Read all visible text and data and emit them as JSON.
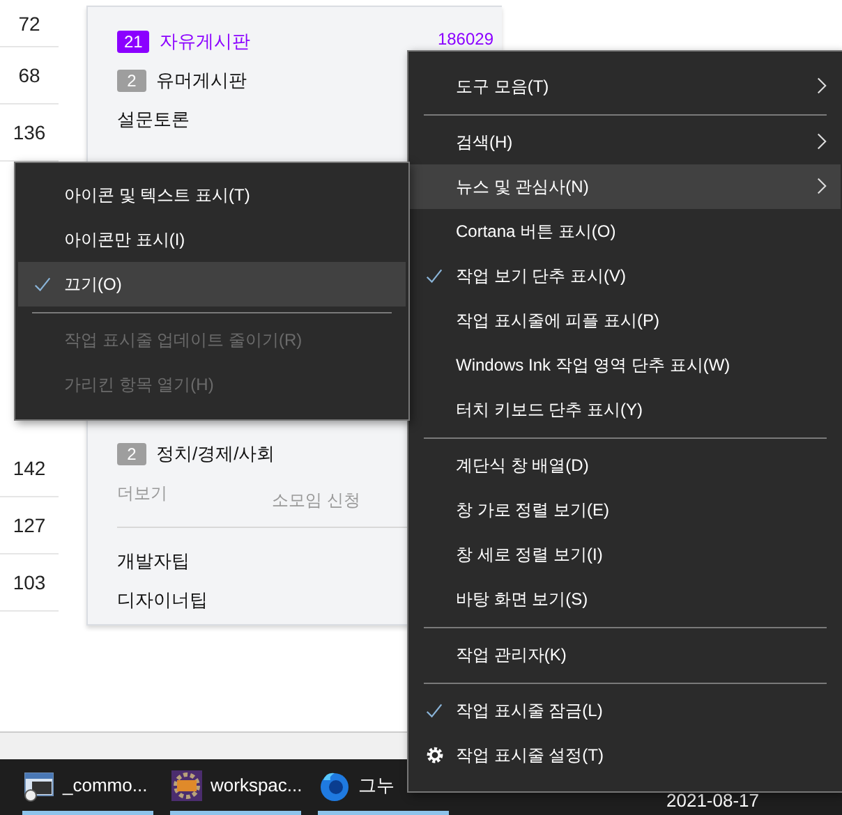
{
  "counts_upper": [
    "72",
    "68",
    "136"
  ],
  "counts_lower": [
    "142",
    "127",
    "103"
  ],
  "boards_upper": [
    {
      "kind": "board",
      "badge": "21",
      "label": "자유게시판",
      "count": "186029",
      "color": "#8b00ff"
    },
    {
      "kind": "board",
      "badge": "2",
      "label": "유머게시판",
      "color": "#9e9e9e"
    },
    {
      "kind": "link",
      "label": "설문토론"
    }
  ],
  "boards_lower": [
    {
      "kind": "board",
      "badge": "2",
      "label": "정치/경제/사회",
      "color": "#9e9e9e"
    }
  ],
  "more": {
    "label": "더보기",
    "apply": "소모임 신청"
  },
  "tips": [
    "개발자팁",
    "디자이너팁"
  ],
  "context_menu": {
    "items": [
      {
        "kind": "item",
        "label": "도구 모음(T)",
        "checked": false,
        "submenu": true,
        "selected": false
      },
      {
        "kind": "separator"
      },
      {
        "kind": "item",
        "label": "검색(H)",
        "checked": false,
        "submenu": true,
        "selected": false
      },
      {
        "kind": "item",
        "label": "뉴스 및 관심사(N)",
        "checked": false,
        "submenu": true,
        "selected": true
      },
      {
        "kind": "item",
        "label": "Cortana 버튼 표시(O)",
        "checked": false,
        "submenu": false,
        "selected": false
      },
      {
        "kind": "item",
        "label": "작업 보기 단추 표시(V)",
        "checked": true,
        "submenu": false,
        "selected": false
      },
      {
        "kind": "item",
        "label": "작업 표시줄에 피플 표시(P)",
        "checked": false,
        "submenu": false,
        "selected": false
      },
      {
        "kind": "item",
        "label": "Windows Ink 작업 영역 단추 표시(W)",
        "checked": false,
        "submenu": false,
        "selected": false
      },
      {
        "kind": "item",
        "label": "터치 키보드 단추 표시(Y)",
        "checked": false,
        "submenu": false,
        "selected": false
      },
      {
        "kind": "separator"
      },
      {
        "kind": "item",
        "label": "계단식 창 배열(D)",
        "checked": false,
        "submenu": false,
        "selected": false
      },
      {
        "kind": "item",
        "label": "창 가로 정렬 보기(E)",
        "checked": false,
        "submenu": false,
        "selected": false
      },
      {
        "kind": "item",
        "label": "창 세로 정렬 보기(I)",
        "checked": false,
        "submenu": false,
        "selected": false
      },
      {
        "kind": "item",
        "label": "바탕 화면 보기(S)",
        "checked": false,
        "submenu": false,
        "selected": false
      },
      {
        "kind": "separator"
      },
      {
        "kind": "item",
        "label": "작업 관리자(K)",
        "checked": false,
        "submenu": false,
        "selected": false
      },
      {
        "kind": "separator"
      },
      {
        "kind": "item",
        "label": "작업 표시줄 잠금(L)",
        "checked": true,
        "submenu": false,
        "selected": false
      },
      {
        "kind": "settings",
        "label": "작업 표시줄 설정(T)",
        "checked": false,
        "submenu": false,
        "selected": false
      }
    ]
  },
  "submenu": {
    "items": [
      {
        "kind": "item",
        "label": "아이콘 및 텍스트 표시(T)",
        "checked": false,
        "disabled": false,
        "selected": false
      },
      {
        "kind": "item",
        "label": "아이콘만 표시(I)",
        "checked": false,
        "disabled": false,
        "selected": false
      },
      {
        "kind": "item",
        "label": "끄기(O)",
        "checked": true,
        "disabled": false,
        "selected": true
      },
      {
        "kind": "separator"
      },
      {
        "kind": "item",
        "label": "작업 표시줄 업데이트 줄이기(R)",
        "checked": false,
        "disabled": true,
        "selected": false
      },
      {
        "kind": "item",
        "label": "가리킨 항목 열기(H)",
        "checked": false,
        "disabled": true,
        "selected": false
      }
    ]
  },
  "taskbar": {
    "apps": [
      {
        "kind": "terminal",
        "label": "_commo..."
      },
      {
        "kind": "ide",
        "label": "workspac..."
      },
      {
        "kind": "browser",
        "label": "그누"
      }
    ],
    "date": "2021-08-17"
  }
}
